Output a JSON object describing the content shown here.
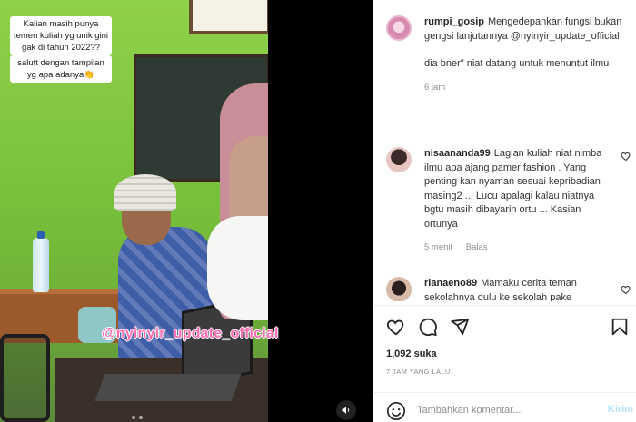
{
  "video": {
    "caption_line1": "Kalian masih punya temen kuliah yg unik gini gak di tahun 2022??",
    "caption_line2": "salutt dengan tampilan yg apa adanya",
    "caption_emoji": "👏",
    "watermark": "@nyinyir_update_official",
    "sound_icon": "speaker-icon"
  },
  "comments": [
    {
      "username": "rumpi_gosip",
      "text": "Mengedepankan fungsi bukan gengsi lanjutannya @nyinyir_update_official",
      "text2": "dia bner\" niat datang untuk menuntut ilmu",
      "time": "6 jam"
    },
    {
      "username": "nisaananda99",
      "text": "Lagian kuliah niat nimba ilmu apa ajang pamer fashion . Yang penting kan nyaman sesuai kepribadian masing2 ... Lucu apalagi kalau niatnya bgtu masih dibayarin ortu ... Kasian ortunya",
      "time": "5 menit",
      "reply": "Balas"
    },
    {
      "username": "rianaeno89",
      "text": "Mamaku cerita teman sekolahnya dulu ke sekolah pake"
    }
  ],
  "actions": {
    "like_icon": "heart-icon",
    "comment_icon": "comment-icon",
    "share_icon": "share-icon",
    "save_icon": "bookmark-icon"
  },
  "likes": "1,092 suka",
  "time_ago": "7 JAM YANG LALU",
  "add_comment": {
    "placeholder": "Tambahkan komentar...",
    "post_label": "Kirim",
    "emoji_icon": "emoji-icon"
  },
  "colors": {
    "watermark": "#ff6eb4",
    "post_button": "#b2dffc",
    "meta_text": "#8e8e8e"
  }
}
